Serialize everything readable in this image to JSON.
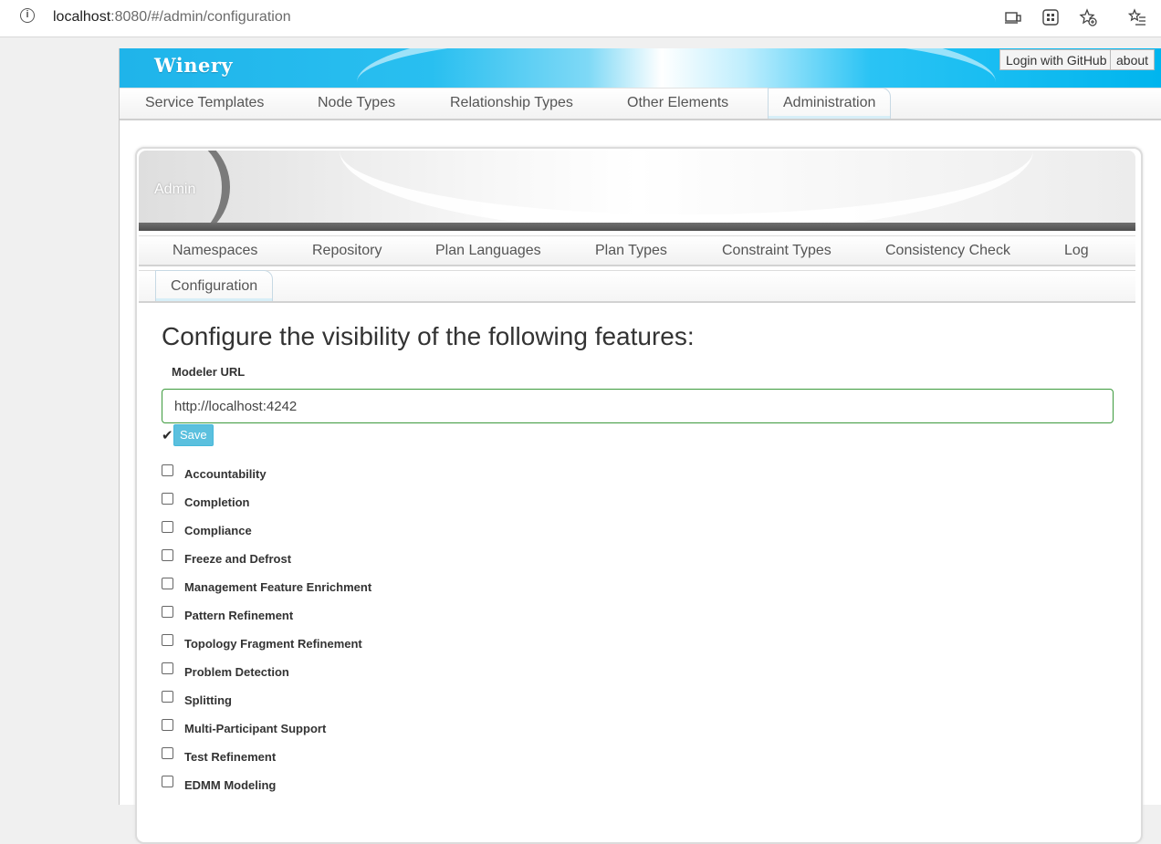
{
  "browser": {
    "url_host": "localhost",
    "url_rest": ":8080/#/admin/configuration"
  },
  "header": {
    "brand": "Winery",
    "login_label": "Login with GitHub",
    "about_label": "about"
  },
  "main_nav": [
    {
      "label": "Service Templates"
    },
    {
      "label": "Node Types"
    },
    {
      "label": "Relationship Types"
    },
    {
      "label": "Other Elements"
    },
    {
      "label": "Administration",
      "active": true
    }
  ],
  "admin": {
    "banner_label": "Admin",
    "tabs": [
      {
        "label": "Namespaces"
      },
      {
        "label": "Repository"
      },
      {
        "label": "Plan Languages"
      },
      {
        "label": "Plan Types"
      },
      {
        "label": "Constraint Types"
      },
      {
        "label": "Consistency Check"
      },
      {
        "label": "Log"
      }
    ],
    "active_tab": "Configuration"
  },
  "config": {
    "title": "Configure the visibility of the following features:",
    "modeler_url_label": "Modeler URL",
    "modeler_url_value": "http://localhost:4242",
    "check_glyph": "✔",
    "save_label": "Save",
    "features": [
      {
        "label": "Accountability",
        "checked": false
      },
      {
        "label": "Completion",
        "checked": false
      },
      {
        "label": "Compliance",
        "checked": false
      },
      {
        "label": "Freeze and Defrost",
        "checked": false
      },
      {
        "label": "Management Feature Enrichment",
        "checked": false
      },
      {
        "label": "Pattern Refinement",
        "checked": false
      },
      {
        "label": "Topology Fragment Refinement",
        "checked": false
      },
      {
        "label": "Problem Detection",
        "checked": false
      },
      {
        "label": "Splitting",
        "checked": false
      },
      {
        "label": "Multi-Participant Support",
        "checked": false
      },
      {
        "label": "Test Refinement",
        "checked": false
      },
      {
        "label": "EDMM Modeling",
        "checked": false
      }
    ]
  },
  "colors": {
    "header_blue": "#1fb4ea",
    "save_button": "#5bc0de",
    "input_border_valid": "#3c9a3c"
  }
}
